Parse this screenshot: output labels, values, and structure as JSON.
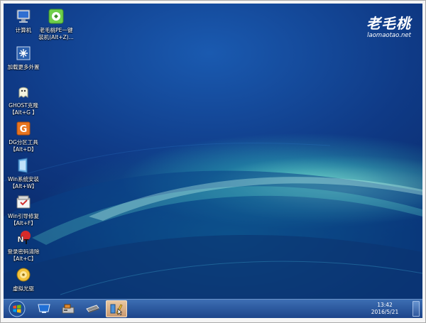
{
  "desktop": {
    "icons": [
      {
        "label": "计算机",
        "icon": "computer-icon"
      },
      {
        "label": "老毛桃PE一键装机(Alt+Z)...",
        "icon": "installer-icon"
      },
      {
        "label": "加载更多外置",
        "icon": "load-more-icon"
      },
      {
        "label": "GHOST克隆【Alt+G】",
        "icon": "ghost-icon"
      },
      {
        "label": "DG分区工具【Alt+D】",
        "icon": "diskgenius-icon"
      },
      {
        "label": "Win系统安装【Alt+W】",
        "icon": "win-install-icon"
      },
      {
        "label": "Win引导修复【Alt+F】",
        "icon": "boot-repair-icon"
      },
      {
        "label": "登录密码清除【Alt+C】",
        "icon": "password-clear-icon"
      },
      {
        "label": "虚拟光驱",
        "icon": "virtual-drive-icon"
      }
    ]
  },
  "desktop_labels": {
    "computer": "计算机",
    "installer_line1": "老毛桃PE一键",
    "installer_line2": "装机(Alt+Z)...",
    "load_more": "加载更多外置",
    "ghost_line1": "GHOST克隆",
    "ghost_line2": "【Alt+G 】",
    "dg_line1": "DG分区工具",
    "dg_line2": "【Alt+D】",
    "win_install_line1": "Win系统安装",
    "win_install_line2": "【Alt+W】",
    "boot_repair_line1": "Win引导修复",
    "boot_repair_line2": "【Alt+F】",
    "password_line1": "登录密码清除",
    "password_line2": "【Alt+C】",
    "virtual_drive": "虚拟光驱"
  },
  "logo": {
    "chinese": "老毛桃",
    "url": "laomaotao.net"
  },
  "taskbar": {
    "start_icon": "windows-start-icon",
    "pinned": [
      "display-icon",
      "tools-icon",
      "drive-icon",
      "pe-tools-icon"
    ],
    "active_index": 3,
    "active_color": "#d9ad84"
  },
  "clock": {
    "time": "13:42",
    "date": "2016/5/21"
  }
}
